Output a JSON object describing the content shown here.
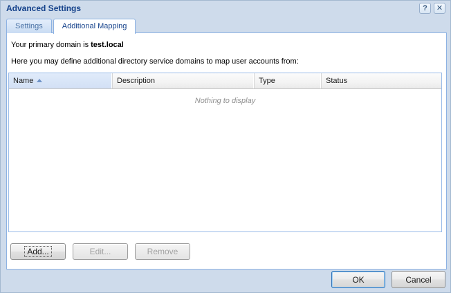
{
  "dialog": {
    "title": "Advanced Settings",
    "help_glyph": "?",
    "close_glyph": "✕"
  },
  "tabs": [
    {
      "label": "Settings",
      "active": false
    },
    {
      "label": "Additional Mapping",
      "active": true
    }
  ],
  "content": {
    "primary_domain_prefix": "Your primary domain is ",
    "primary_domain": "test.local",
    "instruction": "Here you may define additional directory service domains to map user accounts from:"
  },
  "table": {
    "columns": [
      "Name",
      "Description",
      "Type",
      "Status"
    ],
    "sorted_column": "Name",
    "sort_direction": "asc",
    "rows": [],
    "empty_text": "Nothing to display"
  },
  "actions": {
    "add_label": "Add...",
    "edit_label": "Edit...",
    "remove_label": "Remove",
    "edit_enabled": false,
    "remove_enabled": false
  },
  "footer": {
    "ok_label": "OK",
    "cancel_label": "Cancel"
  },
  "colors": {
    "dialog_bg": "#cedbeb",
    "panel_border": "#8db2e3",
    "grid_border": "#99bbe8",
    "title_color": "#15428b",
    "sorted_header_bg": "#d9e6f8"
  }
}
